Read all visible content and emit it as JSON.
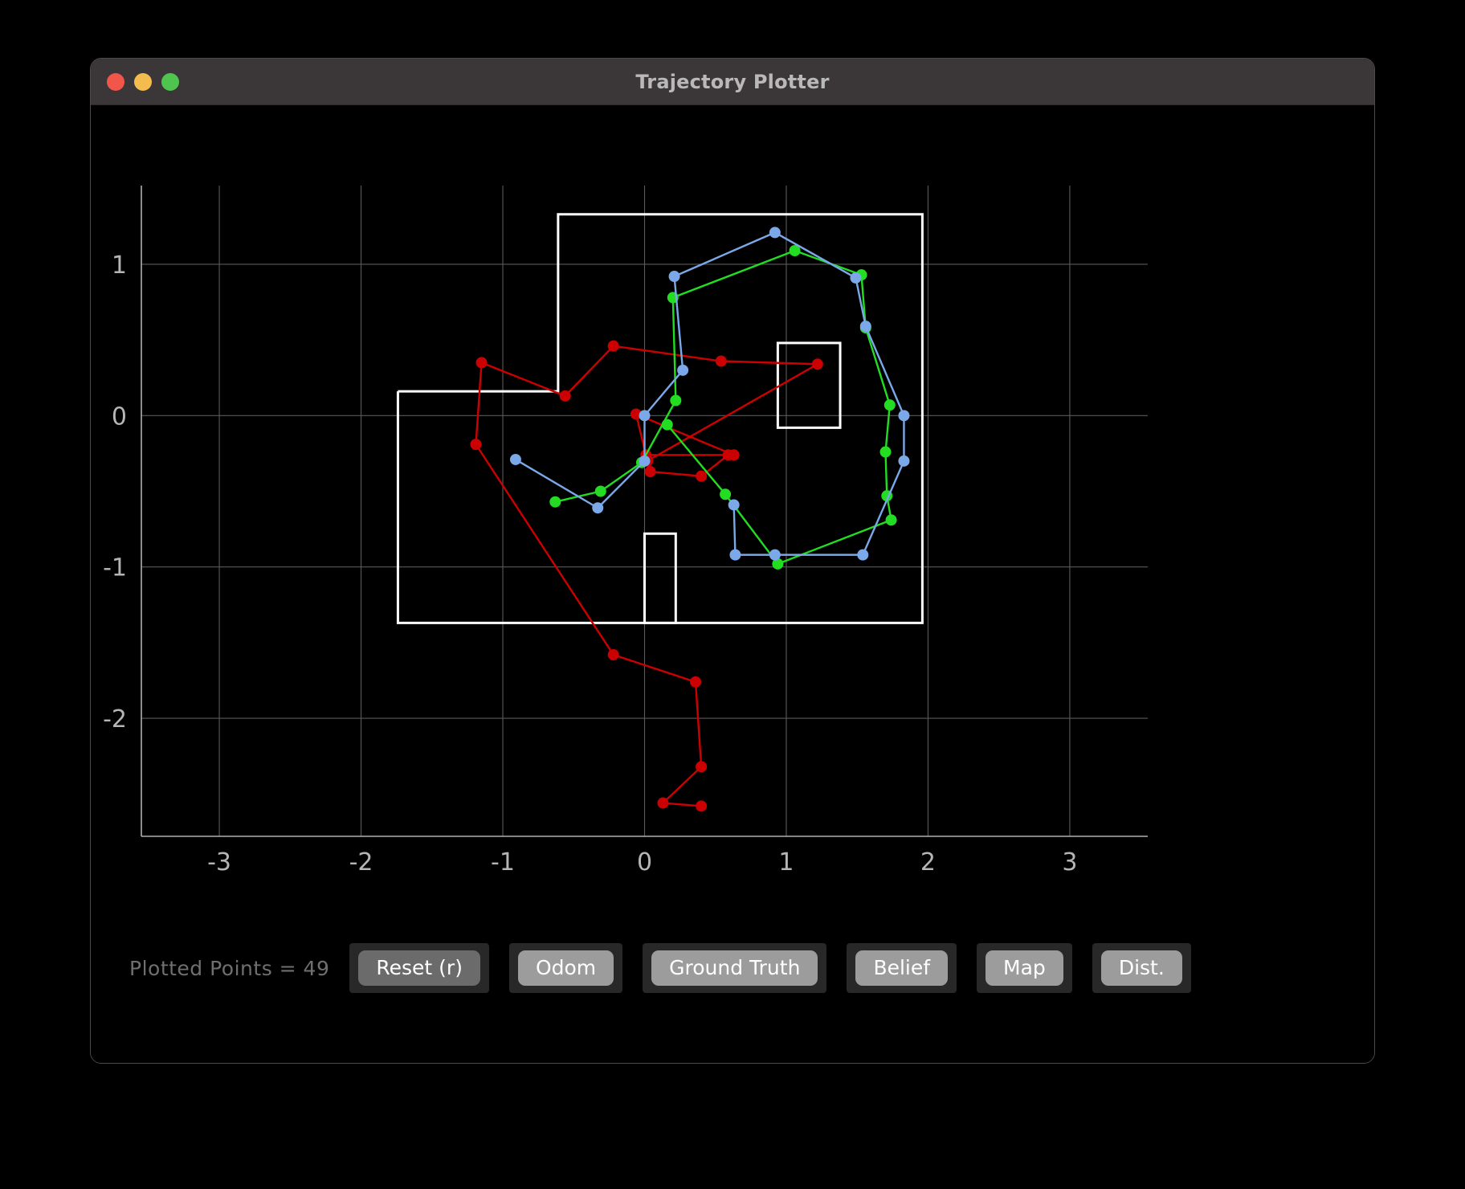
{
  "window": {
    "title": "Trajectory Plotter",
    "traffic_lights": [
      {
        "name": "close-button",
        "color": "#f2564b"
      },
      {
        "name": "minimize-button",
        "color": "#f4bc4f"
      },
      {
        "name": "maximize-button",
        "color": "#4fc54f"
      }
    ]
  },
  "toolbar": {
    "points_label": "Plotted Points = 49",
    "buttons": [
      {
        "label": "Reset (r)",
        "name": "reset-button",
        "style": "dark"
      },
      {
        "label": "Odom",
        "name": "odom-button",
        "style": "light"
      },
      {
        "label": "Ground Truth",
        "name": "ground-truth-button",
        "style": "light"
      },
      {
        "label": "Belief",
        "name": "belief-button",
        "style": "light"
      },
      {
        "label": "Map",
        "name": "map-button",
        "style": "light"
      },
      {
        "label": "Dist.",
        "name": "dist-button",
        "style": "light"
      }
    ]
  },
  "chart_data": {
    "type": "line",
    "title": "Trajectory Plotter",
    "xlabel": "",
    "ylabel": "",
    "xlim": [
      -3.55,
      3.55
    ],
    "ylim": [
      -2.78,
      1.52
    ],
    "xticks": [
      -3,
      -2,
      -1,
      0,
      1,
      2,
      3
    ],
    "yticks": [
      1,
      0,
      -1,
      -2
    ],
    "grid": true,
    "legend": "none",
    "background": "#000000",
    "grid_color": "#5a5a5a",
    "axis_color": "#b0b0b0",
    "series": [
      {
        "name": "Odom",
        "color": "#cc0000",
        "marker": "circle",
        "points": [
          [
            0.4,
            -2.58
          ],
          [
            0.13,
            -2.56
          ],
          [
            0.4,
            -2.32
          ],
          [
            0.36,
            -1.76
          ],
          [
            -0.22,
            -1.58
          ],
          [
            -1.19,
            -0.19
          ],
          [
            -1.15,
            0.35
          ],
          [
            -0.56,
            0.13
          ],
          [
            -0.22,
            0.46
          ],
          [
            0.54,
            0.36
          ],
          [
            1.22,
            0.34
          ],
          [
            0.02,
            -0.3
          ],
          [
            -0.06,
            0.01
          ],
          [
            0.63,
            -0.26
          ],
          [
            0.01,
            -0.26
          ],
          [
            0.04,
            -0.37
          ],
          [
            0.4,
            -0.4
          ],
          [
            0.59,
            -0.26
          ]
        ]
      },
      {
        "name": "Ground Truth",
        "color": "#22dd22",
        "marker": "circle",
        "points": [
          [
            -0.63,
            -0.57
          ],
          [
            -0.31,
            -0.5
          ],
          [
            -0.02,
            -0.31
          ],
          [
            0.22,
            0.1
          ],
          [
            0.2,
            0.78
          ],
          [
            1.06,
            1.09
          ],
          [
            1.53,
            0.93
          ],
          [
            1.56,
            0.58
          ],
          [
            1.73,
            0.07
          ],
          [
            1.7,
            -0.24
          ],
          [
            1.71,
            -0.53
          ],
          [
            1.74,
            -0.69
          ],
          [
            0.94,
            -0.98
          ],
          [
            0.57,
            -0.52
          ],
          [
            0.16,
            -0.06
          ]
        ]
      },
      {
        "name": "Belief",
        "color": "#7aa8e8",
        "marker": "circle",
        "points": [
          [
            -0.91,
            -0.29
          ],
          [
            -0.33,
            -0.61
          ],
          [
            0.0,
            -0.3
          ],
          [
            0.0,
            0.0
          ],
          [
            0.27,
            0.3
          ],
          [
            0.21,
            0.92
          ],
          [
            0.92,
            1.21
          ],
          [
            1.49,
            0.91
          ],
          [
            1.56,
            0.59
          ],
          [
            1.83,
            0.0
          ],
          [
            1.83,
            -0.3
          ],
          [
            1.54,
            -0.92
          ],
          [
            0.92,
            -0.92
          ],
          [
            0.64,
            -0.92
          ],
          [
            0.63,
            -0.59
          ]
        ]
      }
    ],
    "map": {
      "color": "#ffffff",
      "outer_boundary": [
        [
          -1.74,
          0.16
        ],
        [
          -0.61,
          0.16
        ],
        [
          -0.61,
          1.33
        ],
        [
          1.96,
          1.33
        ],
        [
          1.96,
          -1.37
        ],
        [
          -1.74,
          -1.37
        ],
        [
          -1.74,
          0.16
        ]
      ],
      "rooms": [
        {
          "name": "room-upper-right",
          "x0": 0.94,
          "y0": -0.08,
          "x1": 1.38,
          "y1": 0.48
        },
        {
          "name": "room-lower-center",
          "x0": 0.0,
          "y0": -1.37,
          "x1": 0.22,
          "y1": -0.78
        }
      ]
    }
  }
}
